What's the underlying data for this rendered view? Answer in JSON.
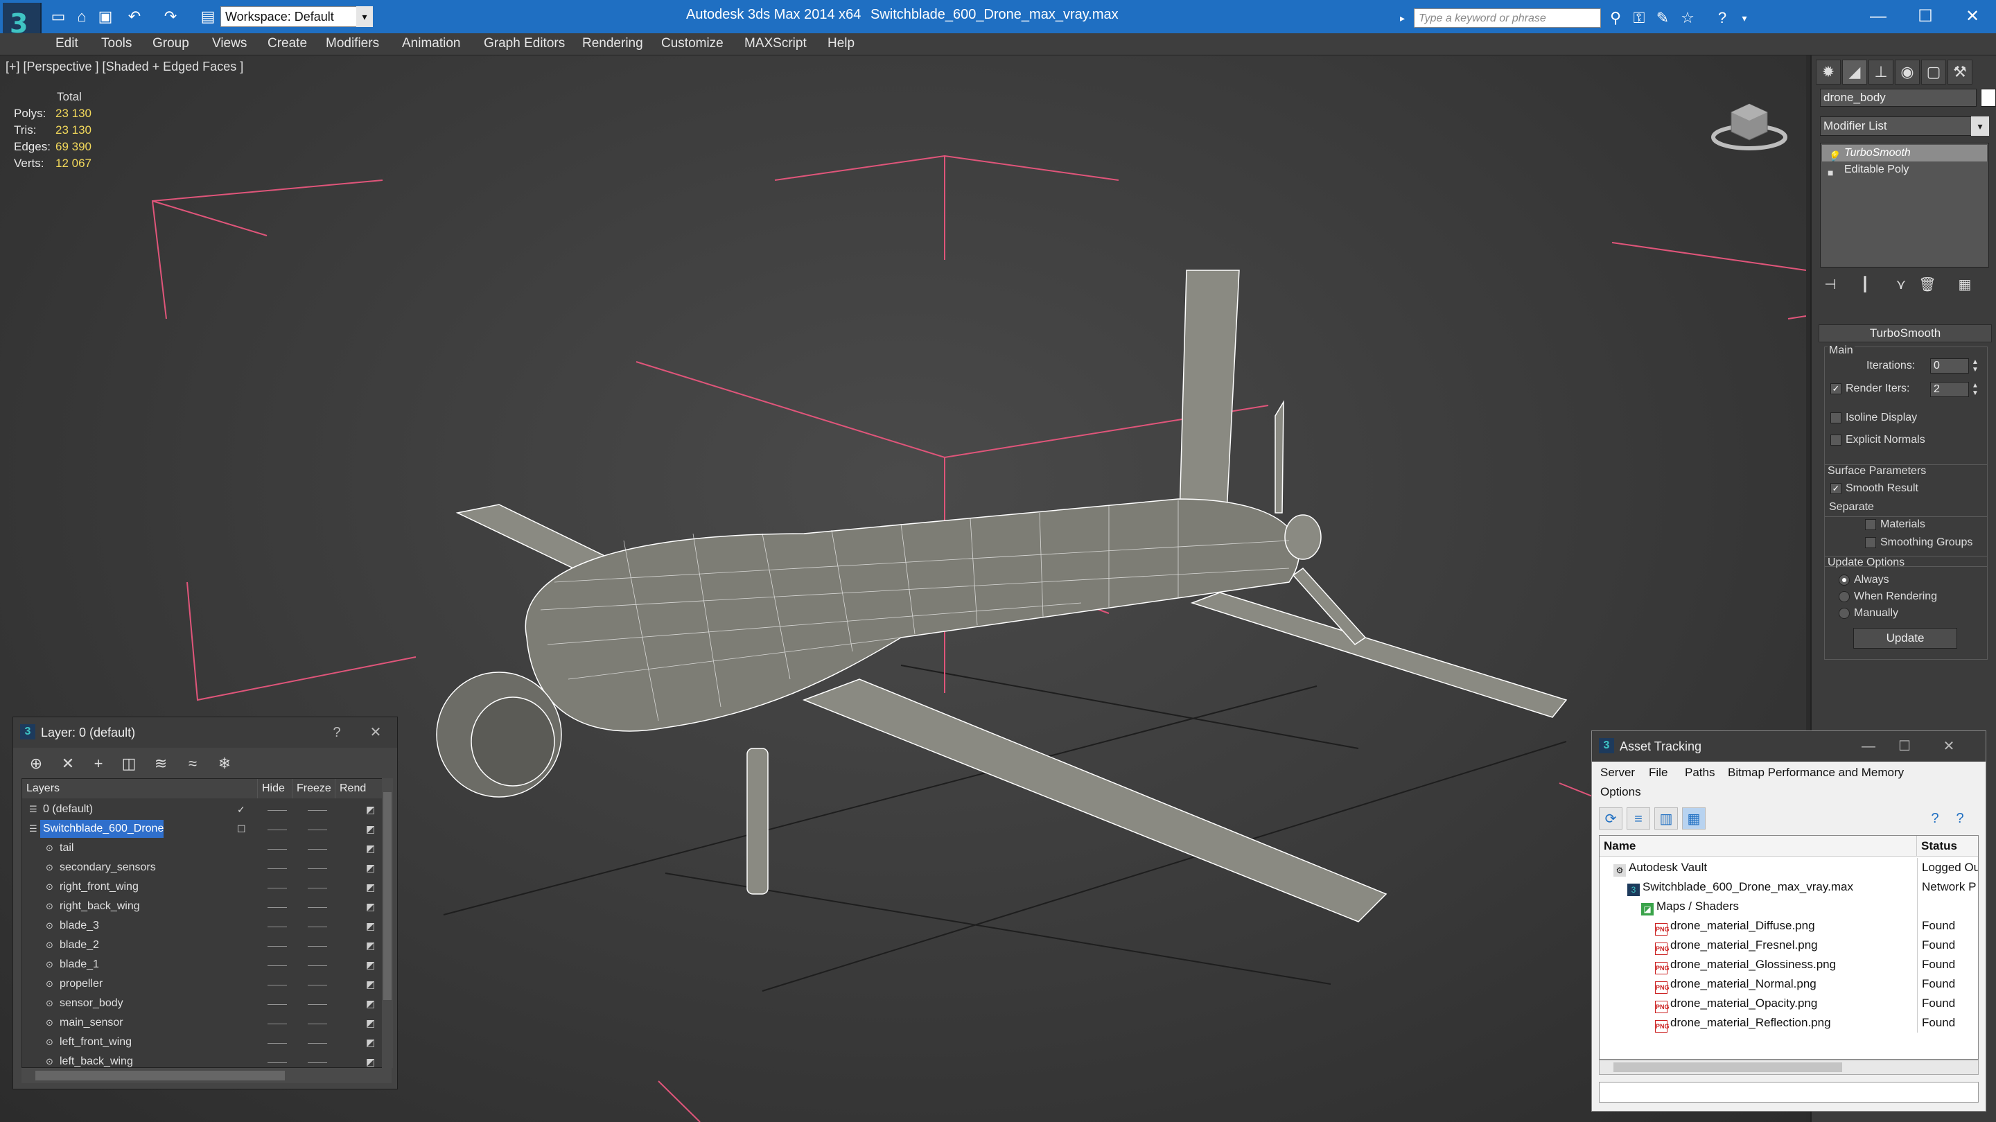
{
  "titlebar": {
    "app_title": "Autodesk 3ds Max  2014 x64",
    "file_title": "Switchblade_600_Drone_max_vray.max",
    "workspace": "Workspace: Default",
    "search_placeholder": "Type a keyword or phrase"
  },
  "menu": [
    "Edit",
    "Tools",
    "Group",
    "Views",
    "Create",
    "Modifiers",
    "Animation",
    "Graph Editors",
    "Rendering",
    "Customize",
    "MAXScript",
    "Help"
  ],
  "viewport": {
    "label": "[+] [Perspective ] [Shaded + Edged Faces ]",
    "stats": {
      "header": "Total",
      "polys_label": "Polys:",
      "polys": "23 130",
      "tris_label": "Tris:",
      "tris": "23 130",
      "edges_label": "Edges:",
      "edges": "69 390",
      "verts_label": "Verts:",
      "verts": "12 067"
    },
    "wire_color": "#ffffff",
    "bbox_color": "#e0557a",
    "grid_color": "#1a1a1a"
  },
  "command_panel": {
    "object_name": "drone_body",
    "modifier_list": "Modifier List",
    "stack": [
      "TurboSmooth",
      "Editable Poly"
    ],
    "turbosmooth": {
      "title": "TurboSmooth",
      "main": "Main",
      "iterations_label": "Iterations:",
      "iterations": "0",
      "render_iters_label": "Render Iters:",
      "render_iters": "2",
      "render_iters_checked": true,
      "isoline": "Isoline Display",
      "explicit": "Explicit Normals",
      "surface_params": "Surface Parameters",
      "smooth_result": "Smooth Result",
      "smooth_result_checked": true,
      "separate": "Separate",
      "materials": "Materials",
      "smoothing_groups": "Smoothing Groups",
      "update_options": "Update Options",
      "always": "Always",
      "when_rendering": "When Rendering",
      "manually": "Manually",
      "selected_update": "Always",
      "update_button": "Update"
    }
  },
  "layer_dialog": {
    "title": "Layer: 0 (default)",
    "help": "?",
    "close": "✕",
    "columns": [
      "Layers",
      "Hide",
      "Freeze",
      "Rend"
    ],
    "rows": [
      {
        "name": "0 (default)",
        "indent": 0,
        "check": "✓"
      },
      {
        "name": "Switchblade_600_Drone",
        "indent": 0,
        "selected": true,
        "check": "☐"
      },
      {
        "name": "tail",
        "indent": 1
      },
      {
        "name": "secondary_sensors",
        "indent": 1
      },
      {
        "name": "right_front_wing",
        "indent": 1
      },
      {
        "name": "right_back_wing",
        "indent": 1
      },
      {
        "name": "blade_3",
        "indent": 1
      },
      {
        "name": "blade_2",
        "indent": 1
      },
      {
        "name": "blade_1",
        "indent": 1
      },
      {
        "name": "propeller",
        "indent": 1
      },
      {
        "name": "sensor_body",
        "indent": 1
      },
      {
        "name": "main_sensor",
        "indent": 1
      },
      {
        "name": "left_front_wing",
        "indent": 1
      },
      {
        "name": "left_back_wing",
        "indent": 1
      }
    ]
  },
  "asset_dialog": {
    "title": "Asset Tracking",
    "menu": [
      "Server",
      "File",
      "Paths",
      "Bitmap Performance and Memory",
      "Options"
    ],
    "columns": [
      "Name",
      "Status"
    ],
    "rows": [
      {
        "name": "Autodesk Vault",
        "status": "Logged Ou",
        "indent": 1,
        "icon": "vault-icon"
      },
      {
        "name": "Switchblade_600_Drone_max_vray.max",
        "status": "Network P",
        "indent": 2,
        "icon": "max-file-icon"
      },
      {
        "name": "Maps / Shaders",
        "status": "",
        "indent": 3,
        "icon": "maps-icon"
      },
      {
        "name": "drone_material_Diffuse.png",
        "status": "Found",
        "indent": 4,
        "icon": "png-icon"
      },
      {
        "name": "drone_material_Fresnel.png",
        "status": "Found",
        "indent": 4,
        "icon": "png-icon"
      },
      {
        "name": "drone_material_Glossiness.png",
        "status": "Found",
        "indent": 4,
        "icon": "png-icon"
      },
      {
        "name": "drone_material_Normal.png",
        "status": "Found",
        "indent": 4,
        "icon": "png-icon"
      },
      {
        "name": "drone_material_Opacity.png",
        "status": "Found",
        "indent": 4,
        "icon": "png-icon"
      },
      {
        "name": "drone_material_Reflection.png",
        "status": "Found",
        "indent": 4,
        "icon": "png-icon"
      }
    ]
  }
}
